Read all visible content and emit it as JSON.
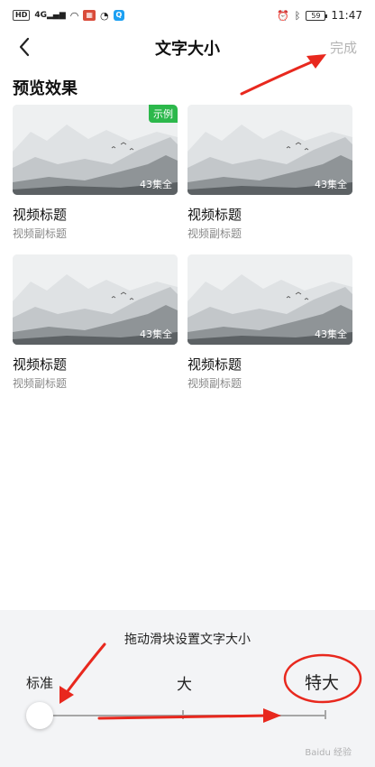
{
  "status_bar": {
    "left_chips": [
      "HD",
      "4G",
      "Wi-Fi",
      "cal",
      "vpn",
      "app"
    ],
    "battery": "59",
    "time": "11:47"
  },
  "header": {
    "back_icon": "chevron-left-icon",
    "title": "文字大小",
    "done_label": "完成"
  },
  "preview": {
    "section_title": "预览效果",
    "cards": [
      {
        "tag": "示例",
        "count": "43集全",
        "title": "视频标题",
        "subtitle": "视频副标题"
      },
      {
        "tag": "",
        "count": "43集全",
        "title": "视频标题",
        "subtitle": "视频副标题"
      },
      {
        "tag": "",
        "count": "43集全",
        "title": "视频标题",
        "subtitle": "视频副标题"
      },
      {
        "tag": "",
        "count": "43集全",
        "title": "视频标题",
        "subtitle": "视频副标题"
      }
    ]
  },
  "slider": {
    "hint": "拖动滑块设置文字大小",
    "labels": [
      "标准",
      "大",
      "特大"
    ],
    "value": 0
  },
  "colors": {
    "tag_green": "#2cb84b",
    "annotation_red": "#e8281e",
    "done_gray": "#b5b5b5",
    "panel_bg": "#f3f4f6"
  },
  "watermark": "Baidu 经验"
}
